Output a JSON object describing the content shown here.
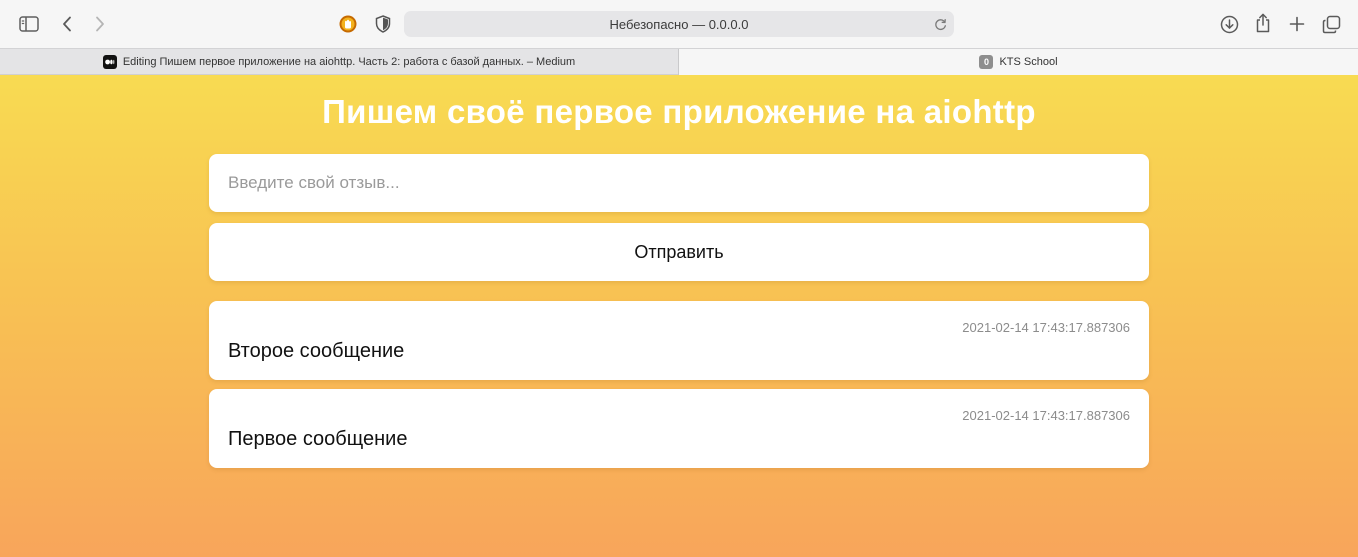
{
  "browser": {
    "address": "Небезопасно — 0.0.0.0",
    "icons": {
      "sidebar": "sidebar-icon",
      "back": "chevron-left-icon",
      "forward": "chevron-right-icon",
      "privacy": "shield-icon",
      "download": "download-icon",
      "share": "share-icon",
      "new_tab": "plus-icon",
      "tab_overview": "tabs-overview-icon",
      "reload": "reload-icon"
    },
    "tabs": [
      {
        "label": "Editing Пишем первое приложение на aiohttp. Часть 2: работа с базой данных. – Medium",
        "favicon": "M●",
        "active": false
      },
      {
        "label": "KTS School",
        "favicon": "0",
        "active": true
      }
    ]
  },
  "page": {
    "title": "Пишем своё первое приложение на aiohttp",
    "input_placeholder": "Введите свой отзыв...",
    "input_value": "",
    "submit_label": "Отправить",
    "messages": [
      {
        "timestamp": "2021-02-14 17:43:17.887306",
        "text": "Второе сообщение"
      },
      {
        "timestamp": "2021-02-14 17:43:17.887306",
        "text": "Первое сообщение"
      }
    ]
  },
  "colors": {
    "gradient_top": "#f8db52",
    "gradient_bottom": "#f8a55b",
    "title": "#ffffff",
    "card": "#ffffff"
  }
}
